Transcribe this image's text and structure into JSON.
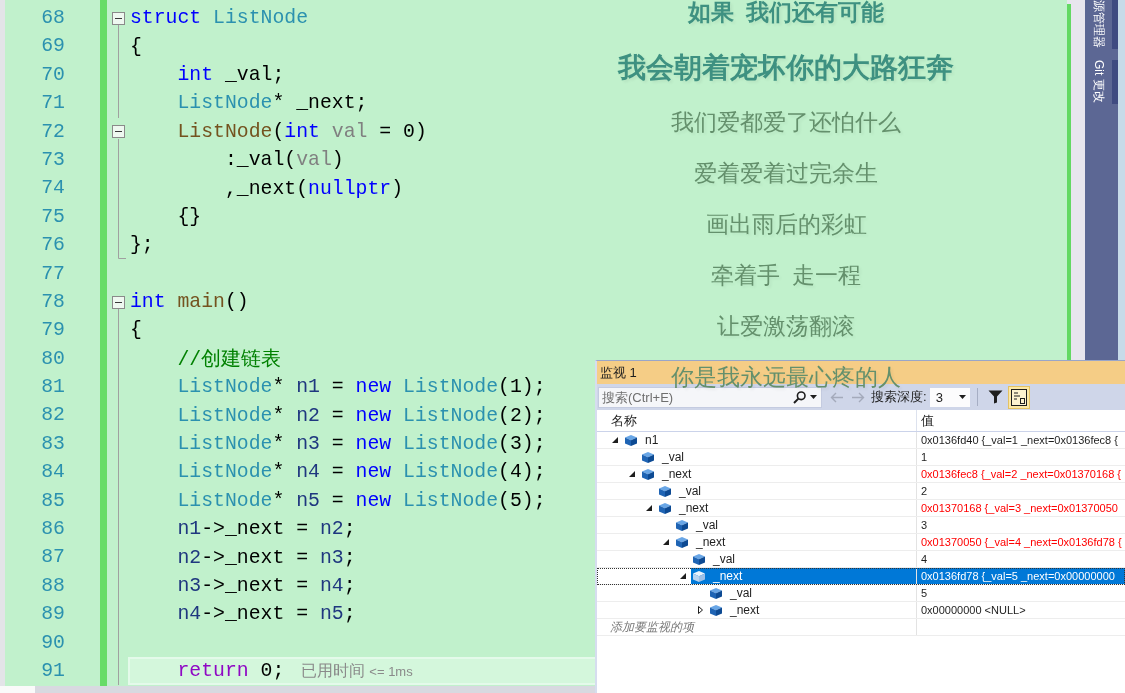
{
  "editor": {
    "lines": [
      {
        "number": "68",
        "fold": {
          "kind": "start",
          "expanded": true
        },
        "current": false,
        "tokens": [
          {
            "kind": "keyword",
            "text": "struct"
          },
          {
            "kind": "type",
            "text": " ListNode"
          }
        ]
      },
      {
        "number": "69",
        "fold": {
          "kind": "inside"
        },
        "current": false,
        "tokens": [
          {
            "kind": "plain",
            "text": "{"
          }
        ]
      },
      {
        "number": "70",
        "fold": {
          "kind": "inside"
        },
        "current": false,
        "tokens": [
          {
            "kind": "keyword",
            "text": "    int"
          },
          {
            "kind": "plain",
            "text": " _val;"
          }
        ]
      },
      {
        "number": "71",
        "fold": {
          "kind": "inside"
        },
        "current": false,
        "tokens": [
          {
            "kind": "type",
            "text": "    ListNode"
          },
          {
            "kind": "plain",
            "text": "* _next;"
          }
        ]
      },
      {
        "number": "72",
        "fold": {
          "kind": "start",
          "expanded": true
        },
        "current": false,
        "tokens": [
          {
            "kind": "function",
            "text": "    ListNode"
          },
          {
            "kind": "plain",
            "text": "("
          },
          {
            "kind": "keyword",
            "text": "int"
          },
          {
            "kind": "param",
            "text": " val"
          },
          {
            "kind": "plain",
            "text": " = 0)"
          }
        ]
      },
      {
        "number": "73",
        "fold": {
          "kind": "inside"
        },
        "current": false,
        "tokens": [
          {
            "kind": "plain",
            "text": "        :_val("
          },
          {
            "kind": "param",
            "text": "val"
          },
          {
            "kind": "plain",
            "text": ")"
          }
        ]
      },
      {
        "number": "74",
        "fold": {
          "kind": "inside"
        },
        "current": false,
        "tokens": [
          {
            "kind": "plain",
            "text": "        ,_next("
          },
          {
            "kind": "keyword",
            "text": "nullptr"
          },
          {
            "kind": "plain",
            "text": ")"
          }
        ]
      },
      {
        "number": "75",
        "fold": {
          "kind": "inside"
        },
        "current": false,
        "tokens": [
          {
            "kind": "plain",
            "text": "    {}"
          }
        ]
      },
      {
        "number": "76",
        "fold": {
          "kind": "end"
        },
        "current": false,
        "tokens": [
          {
            "kind": "plain",
            "text": "};"
          }
        ]
      },
      {
        "number": "77",
        "current": false
      },
      {
        "number": "78",
        "fold": {
          "kind": "start",
          "expanded": true
        },
        "current": false,
        "tokens": [
          {
            "kind": "keyword",
            "text": "int"
          },
          {
            "kind": "function",
            "text": " main"
          },
          {
            "kind": "plain",
            "text": "()"
          }
        ]
      },
      {
        "number": "79",
        "fold": {
          "kind": "inside"
        },
        "current": false,
        "tokens": [
          {
            "kind": "plain",
            "text": "{"
          }
        ]
      },
      {
        "number": "80",
        "fold": {
          "kind": "inside"
        },
        "current": false,
        "tokens": [
          {
            "kind": "comment",
            "text": "    //创建链表"
          }
        ]
      },
      {
        "number": "81",
        "fold": {
          "kind": "inside"
        },
        "current": false,
        "tokens": [
          {
            "kind": "type",
            "text": "    ListNode"
          },
          {
            "kind": "plain",
            "text": "* "
          },
          {
            "kind": "local",
            "text": "n1"
          },
          {
            "kind": "plain",
            "text": " = "
          },
          {
            "kind": "keyword",
            "text": "new"
          },
          {
            "kind": "type",
            "text": " ListNode"
          },
          {
            "kind": "plain",
            "text": "(1);"
          }
        ]
      },
      {
        "number": "82",
        "fold": {
          "kind": "inside"
        },
        "current": false,
        "tokens": [
          {
            "kind": "type",
            "text": "    ListNode"
          },
          {
            "kind": "plain",
            "text": "* "
          },
          {
            "kind": "local",
            "text": "n2"
          },
          {
            "kind": "plain",
            "text": " = "
          },
          {
            "kind": "keyword",
            "text": "new"
          },
          {
            "kind": "type",
            "text": " ListNode"
          },
          {
            "kind": "plain",
            "text": "(2);"
          }
        ]
      },
      {
        "number": "83",
        "fold": {
          "kind": "inside"
        },
        "current": false,
        "tokens": [
          {
            "kind": "type",
            "text": "    ListNode"
          },
          {
            "kind": "plain",
            "text": "* "
          },
          {
            "kind": "local",
            "text": "n3"
          },
          {
            "kind": "plain",
            "text": " = "
          },
          {
            "kind": "keyword",
            "text": "new"
          },
          {
            "kind": "type",
            "text": " ListNode"
          },
          {
            "kind": "plain",
            "text": "(3);"
          }
        ]
      },
      {
        "number": "84",
        "fold": {
          "kind": "inside"
        },
        "current": false,
        "tokens": [
          {
            "kind": "type",
            "text": "    ListNode"
          },
          {
            "kind": "plain",
            "text": "* "
          },
          {
            "kind": "local",
            "text": "n4"
          },
          {
            "kind": "plain",
            "text": " = "
          },
          {
            "kind": "keyword",
            "text": "new"
          },
          {
            "kind": "type",
            "text": " ListNode"
          },
          {
            "kind": "plain",
            "text": "(4);"
          }
        ]
      },
      {
        "number": "85",
        "fold": {
          "kind": "inside"
        },
        "current": false,
        "tokens": [
          {
            "kind": "type",
            "text": "    ListNode"
          },
          {
            "kind": "plain",
            "text": "* "
          },
          {
            "kind": "local",
            "text": "n5"
          },
          {
            "kind": "plain",
            "text": " = "
          },
          {
            "kind": "keyword",
            "text": "new"
          },
          {
            "kind": "type",
            "text": " ListNode"
          },
          {
            "kind": "plain",
            "text": "(5);"
          }
        ]
      },
      {
        "number": "86",
        "fold": {
          "kind": "inside"
        },
        "current": false,
        "tokens": [
          {
            "kind": "local",
            "text": "    n1"
          },
          {
            "kind": "plain",
            "text": "->_next = "
          },
          {
            "kind": "local",
            "text": "n2"
          },
          {
            "kind": "plain",
            "text": ";"
          }
        ]
      },
      {
        "number": "87",
        "fold": {
          "kind": "inside"
        },
        "current": false,
        "tokens": [
          {
            "kind": "local",
            "text": "    n2"
          },
          {
            "kind": "plain",
            "text": "->_next = "
          },
          {
            "kind": "local",
            "text": "n3"
          },
          {
            "kind": "plain",
            "text": ";"
          }
        ]
      },
      {
        "number": "88",
        "fold": {
          "kind": "inside"
        },
        "current": false,
        "tokens": [
          {
            "kind": "local",
            "text": "    n3"
          },
          {
            "kind": "plain",
            "text": "->_next = "
          },
          {
            "kind": "local",
            "text": "n4"
          },
          {
            "kind": "plain",
            "text": ";"
          }
        ]
      },
      {
        "number": "89",
        "fold": {
          "kind": "inside"
        },
        "current": false,
        "tokens": [
          {
            "kind": "local",
            "text": "    n4"
          },
          {
            "kind": "plain",
            "text": "->_next = "
          },
          {
            "kind": "local",
            "text": "n5"
          },
          {
            "kind": "plain",
            "text": ";"
          }
        ]
      },
      {
        "number": "90",
        "fold": {
          "kind": "inside"
        },
        "current": false
      },
      {
        "number": "91",
        "fold": {
          "kind": "inside"
        },
        "current": true,
        "tokens": [
          {
            "kind": "control",
            "text": "    return"
          },
          {
            "kind": "plain",
            "text": " 0;"
          }
        ],
        "hint": {
          "label": "已用时间",
          "value": "<= 1ms"
        }
      }
    ]
  },
  "lyrics": [
    {
      "text": "如果  我们还有可能",
      "sung": true,
      "selected": false
    },
    {
      "text": "我会朝着宠坏你的大路狂奔",
      "sung": true,
      "selected": true
    },
    {
      "text": "我们爱都爱了还怕什么",
      "sung": false,
      "selected": false
    },
    {
      "text": "爱着爱着过完余生",
      "sung": false,
      "selected": false
    },
    {
      "text": "画出雨后的彩虹",
      "sung": false,
      "selected": false
    },
    {
      "text": "牵着手  走一程",
      "sung": false,
      "selected": false
    },
    {
      "text": "让爱激荡翻滚",
      "sung": false,
      "selected": false
    },
    {
      "text": "你是我永远最心疼的人",
      "sung": false,
      "selected": false
    }
  ],
  "sidebar": {
    "tabs": [
      "源管理器",
      "Git 更改"
    ]
  },
  "watch_window": {
    "title": "监视 1",
    "search": {
      "placeholder": "搜索(Ctrl+E)"
    },
    "nav": [
      {
        "kind": "back",
        "disabled": true
      },
      {
        "kind": "forward",
        "disabled": true
      }
    ],
    "depth": {
      "label": "搜索深度:",
      "value": "3"
    },
    "tools": [
      {
        "kind": "filter",
        "selected": false
      },
      {
        "kind": "view",
        "selected": true
      }
    ],
    "columns": [
      "名称",
      "值"
    ],
    "items": [
      {
        "name": "n1",
        "value": "0x0136fd40 {_val=1 _next=0x0136fec8 {",
        "kind": "pointer",
        "expanded": true,
        "changed": false,
        "selected": false,
        "children": [
          {
            "name": "_val",
            "value": "1",
            "kind": "field",
            "changed": false,
            "selected": false
          },
          {
            "name": "_next",
            "value": "0x0136fec8 {_val=2 _next=0x01370168 {",
            "kind": "pointer",
            "expanded": true,
            "changed": true,
            "selected": false,
            "children": [
              {
                "name": "_val",
                "value": "2",
                "kind": "field",
                "changed": false,
                "selected": false
              },
              {
                "name": "_next",
                "value": "0x01370168 {_val=3 _next=0x01370050",
                "kind": "pointer",
                "expanded": true,
                "changed": true,
                "selected": false,
                "children": [
                  {
                    "name": "_val",
                    "value": "3",
                    "kind": "field",
                    "changed": false,
                    "selected": false
                  },
                  {
                    "name": "_next",
                    "value": "0x01370050 {_val=4 _next=0x0136fd78 {",
                    "kind": "pointer",
                    "expanded": true,
                    "changed": true,
                    "selected": false,
                    "children": [
                      {
                        "name": "_val",
                        "value": "4",
                        "kind": "field",
                        "changed": false,
                        "selected": false
                      },
                      {
                        "name": "_next",
                        "value": "0x0136fd78 {_val=5 _next=0x00000000",
                        "kind": "pointer",
                        "expanded": true,
                        "changed": false,
                        "selected": true,
                        "children": [
                          {
                            "name": "_val",
                            "value": "5",
                            "kind": "field",
                            "changed": false,
                            "selected": false
                          },
                          {
                            "name": "_next",
                            "value": "0x00000000 <NULL>",
                            "kind": "pointer",
                            "expanded": false,
                            "changed": false,
                            "selected": false
                          }
                        ]
                      }
                    ]
                  }
                ]
              }
            ]
          }
        ]
      }
    ],
    "add_item": {
      "placeholder": "添加要监视的项"
    }
  }
}
